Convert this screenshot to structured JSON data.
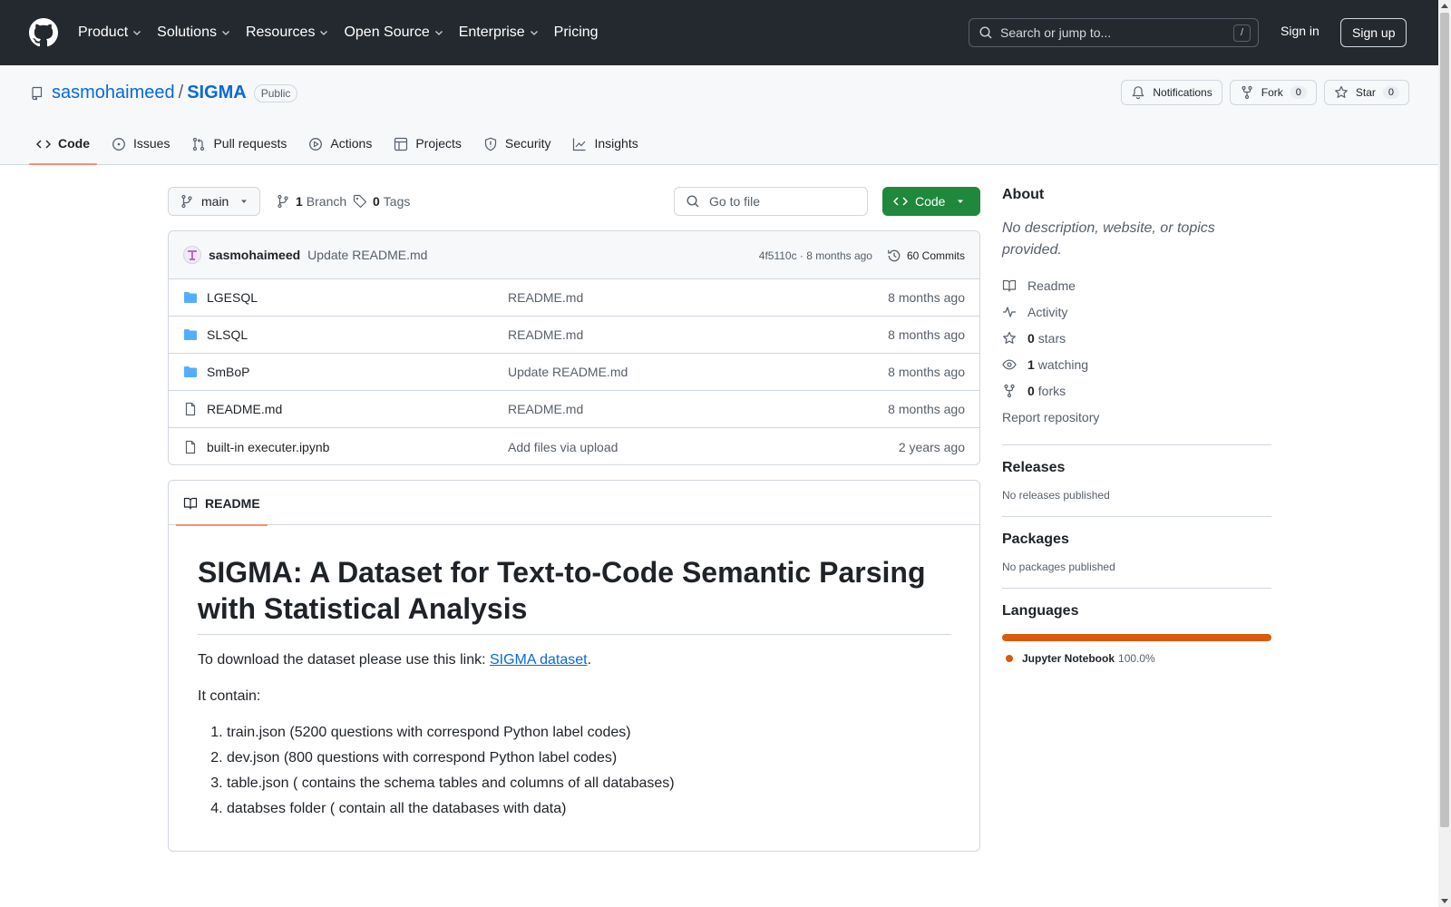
{
  "topnav": {
    "items": [
      {
        "label": "Product",
        "dropdown": true
      },
      {
        "label": "Solutions",
        "dropdown": true
      },
      {
        "label": "Resources",
        "dropdown": true
      },
      {
        "label": "Open Source",
        "dropdown": true
      },
      {
        "label": "Enterprise",
        "dropdown": true
      },
      {
        "label": "Pricing",
        "dropdown": false
      }
    ],
    "search_placeholder": "Search or jump to...",
    "search_key": "/",
    "signin": "Sign in",
    "signup": "Sign up"
  },
  "repo": {
    "owner": "sasmohaimeed",
    "separator": "/",
    "name": "SIGMA",
    "visibility": "Public",
    "actions": {
      "notifications": "Notifications",
      "fork": "Fork",
      "fork_count": "0",
      "star": "Star",
      "star_count": "0"
    },
    "tabs": [
      "Code",
      "Issues",
      "Pull requests",
      "Actions",
      "Projects",
      "Security",
      "Insights"
    ]
  },
  "controls": {
    "branch": "main",
    "branch_count": "1",
    "branch_label": "Branch",
    "tag_count": "0",
    "tag_label": "Tags",
    "goto_placeholder": "Go to file",
    "code_button": "Code"
  },
  "commit": {
    "author": "sasmohaimeed",
    "message": "Update README.md",
    "hash_age": "4f5110c · 8 months ago",
    "commits": "60 Commits"
  },
  "files": [
    {
      "type": "folder",
      "name": "LGESQL",
      "message": "README.md",
      "age": "8 months ago"
    },
    {
      "type": "folder",
      "name": "SLSQL",
      "message": "README.md",
      "age": "8 months ago"
    },
    {
      "type": "folder",
      "name": "SmBoP",
      "message": "Update README.md",
      "age": "8 months ago"
    },
    {
      "type": "file",
      "name": "README.md",
      "message": "README.md",
      "age": "8 months ago"
    },
    {
      "type": "file",
      "name": "built-in executer.ipynb",
      "message": "Add files via upload",
      "age": "2 years ago"
    }
  ],
  "readme": {
    "tab": "README",
    "title": "SIGMA: A Dataset for Text-to-Code Semantic Parsing with Statistical Analysis",
    "p1_prefix": "To download the dataset please use this link: ",
    "p1_link": "SIGMA dataset",
    "p1_suffix": ".",
    "p2": "It contain:",
    "list": [
      "train.json (5200 questions with correspond Python label codes)",
      "dev.json (800 questions with correspond Python label codes)",
      "table.json ( contains the schema tables and columns of all databases)",
      "databses folder ( contain all the databases with data)"
    ]
  },
  "about": {
    "heading": "About",
    "description": "No description, website, or topics provided.",
    "readme": "Readme",
    "activity": "Activity",
    "stars_count": "0",
    "stars_label": "stars",
    "watching_count": "1",
    "watching_label": "watching",
    "forks_count": "0",
    "forks_label": "forks",
    "report": "Report repository"
  },
  "releases": {
    "heading": "Releases",
    "text": "No releases published"
  },
  "packages": {
    "heading": "Packages",
    "text": "No packages published"
  },
  "languages": {
    "heading": "Languages",
    "items": [
      {
        "name": "Jupyter Notebook",
        "percent": "100.0%",
        "color": "#da5b0b"
      }
    ]
  },
  "colors": {
    "header_bg": "#24292f",
    "primary_green": "#1f883d",
    "link": "#0969da",
    "accent_underline": "#fd8c73"
  }
}
